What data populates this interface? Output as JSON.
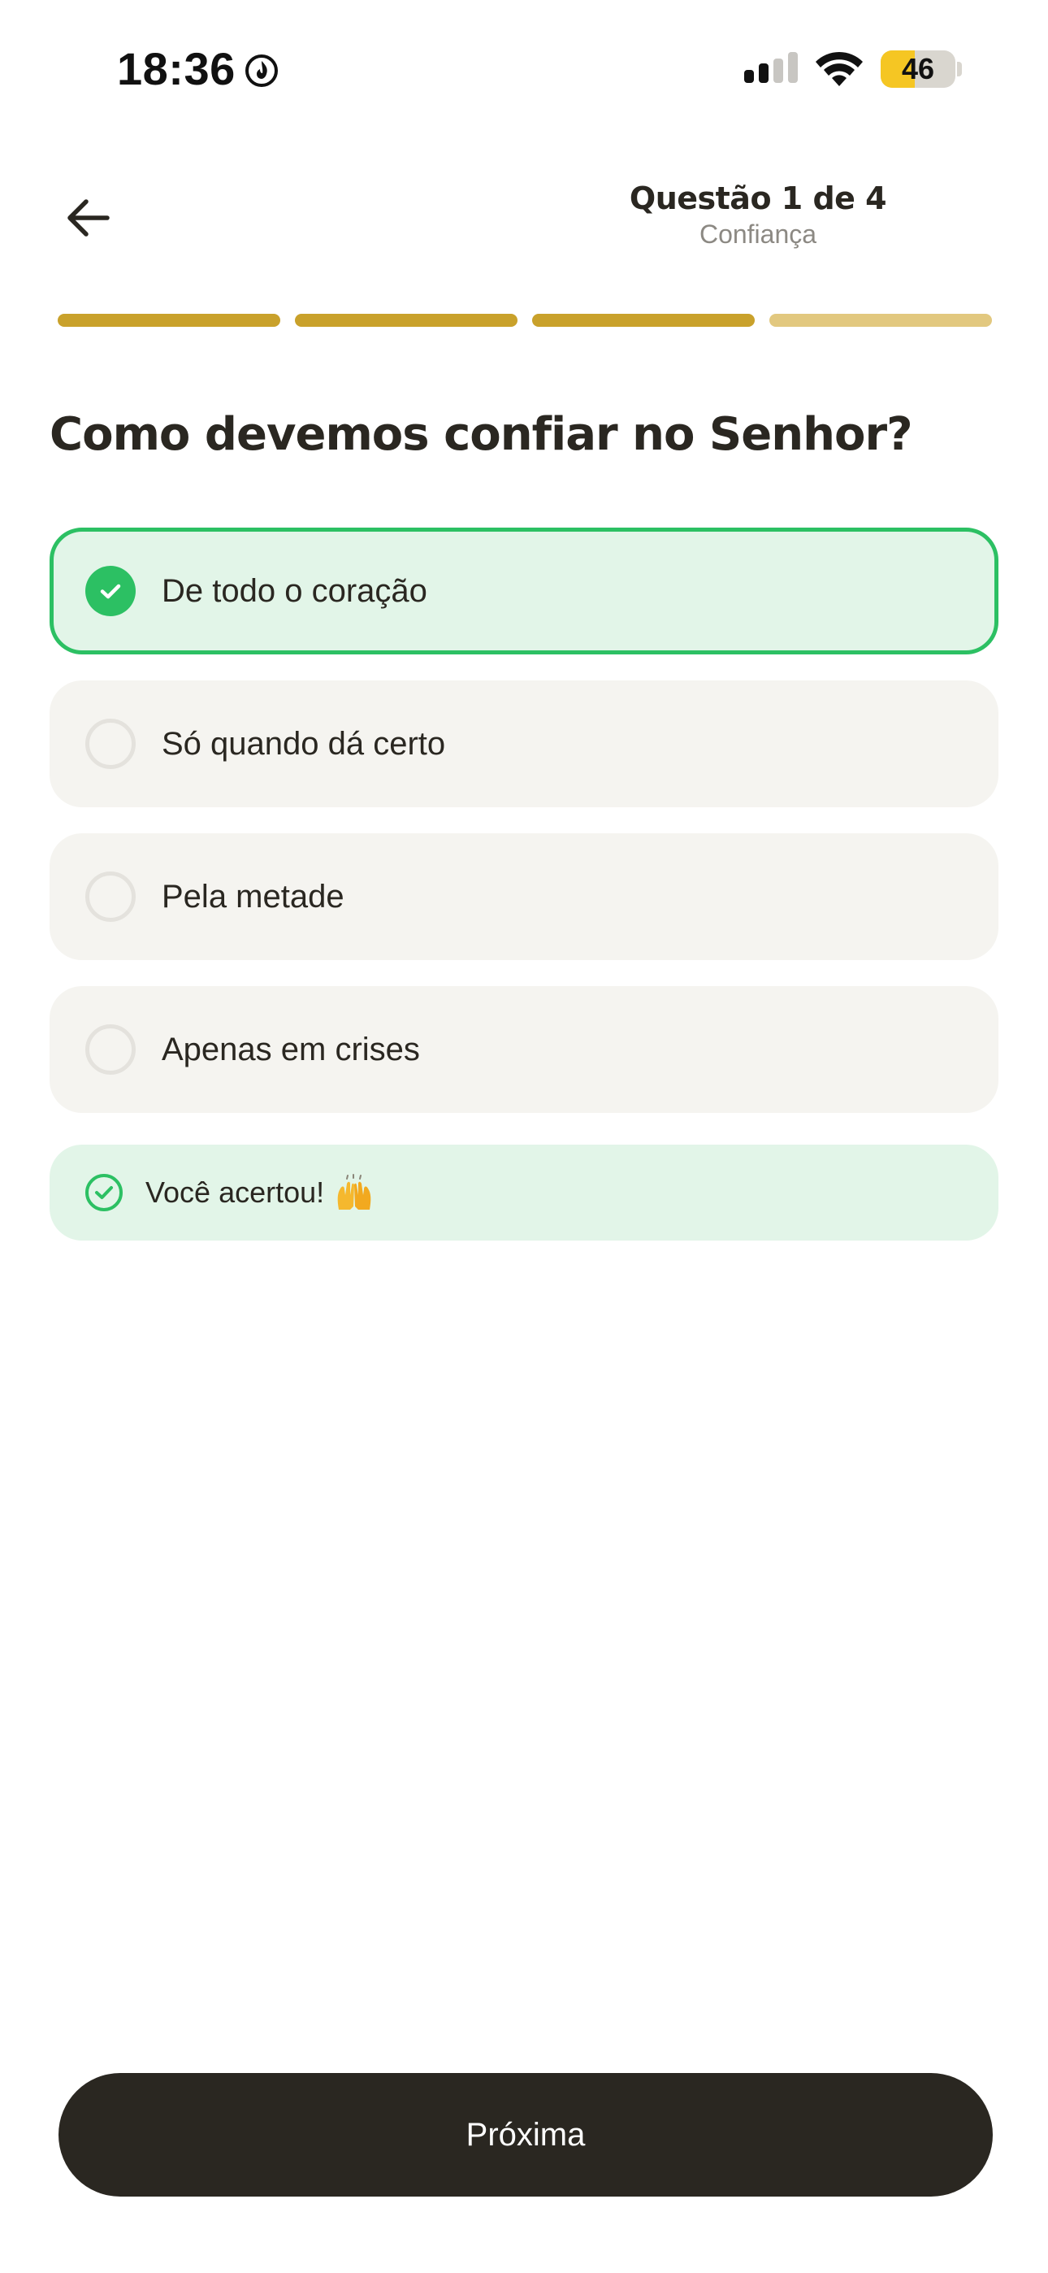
{
  "status_bar": {
    "time": "18:36",
    "battery_level": "46",
    "battery_fraction": 0.46,
    "icons": [
      "flame-icon",
      "signal-icon",
      "wifi-icon",
      "battery-icon"
    ]
  },
  "header": {
    "back_icon": "arrow-left-icon",
    "question_counter": "Questão 1 de 4",
    "category": "Confiança"
  },
  "progress": {
    "total": 4,
    "completed": 3,
    "segments": [
      {
        "state": "filled",
        "color": "#c9a12b"
      },
      {
        "state": "filled",
        "color": "#c9a12b"
      },
      {
        "state": "filled",
        "color": "#c9a12b"
      },
      {
        "state": "pending",
        "color": "#e2c87f"
      }
    ]
  },
  "question": {
    "title": "Como devemos confiar no Senhor?"
  },
  "options": [
    {
      "label": "De todo o coração",
      "selected": true,
      "correct": true
    },
    {
      "label": "Só quando dá certo",
      "selected": false,
      "correct": false
    },
    {
      "label": "Pela metade",
      "selected": false,
      "correct": false
    },
    {
      "label": "Apenas em crises",
      "selected": false,
      "correct": false
    }
  ],
  "feedback": {
    "icon": "check-circle-icon",
    "text": "Você acertou!",
    "emoji_icon": "raising-hands-icon"
  },
  "footer": {
    "next_label": "Próxima"
  },
  "colors": {
    "accent_gold": "#c9a12b",
    "accent_gold_light": "#e2c87f",
    "success_green": "#2cc063",
    "success_bg": "#e2f5e8",
    "option_bg": "#f5f4f0",
    "dark": "#2a2721"
  }
}
